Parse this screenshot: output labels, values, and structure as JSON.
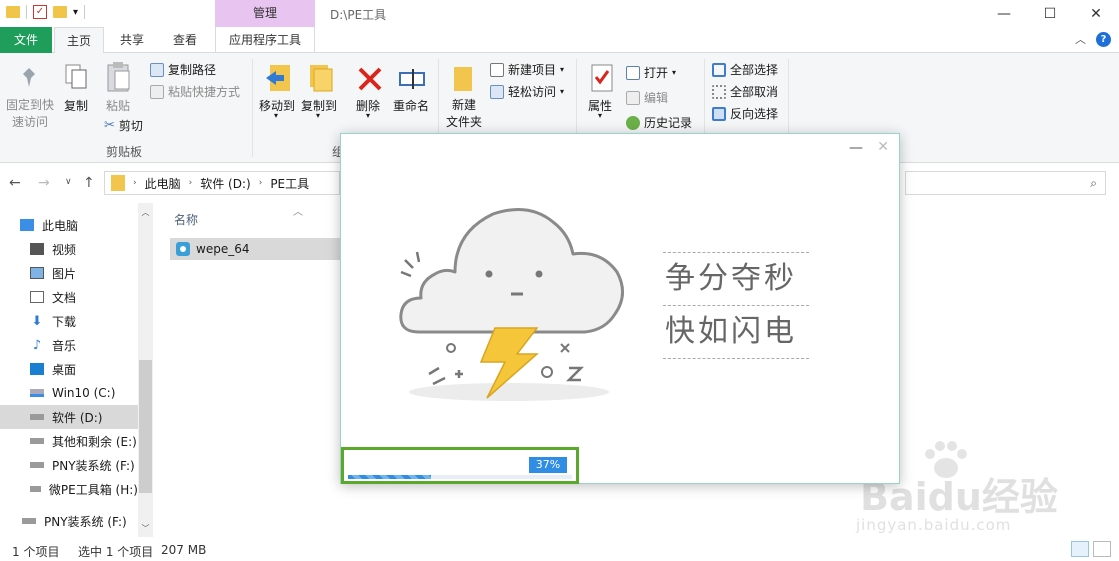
{
  "window": {
    "title": "D:\\PE工具",
    "manage_tab": "管理",
    "minimize": "—",
    "maximize": "☐",
    "close": "✕"
  },
  "tabs": {
    "file": "文件",
    "home": "主页",
    "share": "共享",
    "view": "查看",
    "app_tools": "应用程序工具"
  },
  "ribbon": {
    "pin_quick_access": "固定到快速访问",
    "copy": "复制",
    "paste": "粘贴",
    "copy_path": "复制路径",
    "paste_shortcut": "粘贴快捷方式",
    "cut": "剪切",
    "clipboard_group": "剪贴板",
    "move_to": "移动到",
    "copy_to": "复制到",
    "delete": "删除",
    "rename": "重命名",
    "organize_group_partial": "组",
    "new_folder": "新建\n文件夹",
    "new_item": "新建项目",
    "easy_access": "轻松访问",
    "properties": "属性",
    "open": "打开",
    "edit": "编辑",
    "history": "历史记录",
    "select_all": "全部选择",
    "select_none": "全部取消",
    "invert_selection": "反向选择"
  },
  "address": {
    "breadcrumb": [
      "此电脑",
      "软件 (D:)",
      "PE工具"
    ]
  },
  "sidebar": {
    "items": [
      {
        "label": "此电脑",
        "icon": "computer-icon"
      },
      {
        "label": "视频",
        "icon": "video-icon"
      },
      {
        "label": "图片",
        "icon": "pictures-icon"
      },
      {
        "label": "文档",
        "icon": "documents-icon"
      },
      {
        "label": "下载",
        "icon": "download-icon"
      },
      {
        "label": "音乐",
        "icon": "music-icon"
      },
      {
        "label": "桌面",
        "icon": "desktop-icon"
      },
      {
        "label": "Win10 (C:)",
        "icon": "system-drive-icon"
      },
      {
        "label": "软件 (D:)",
        "icon": "drive-icon"
      },
      {
        "label": "其他和剩余 (E:)",
        "icon": "drive-icon"
      },
      {
        "label": "PNY装系统 (F:)",
        "icon": "drive-icon"
      },
      {
        "label": "微PE工具箱 (H:)",
        "icon": "drive-icon"
      },
      {
        "label": "PNY装系统 (F:)",
        "icon": "drive-icon"
      }
    ]
  },
  "filelist": {
    "column_name": "名称",
    "files": [
      {
        "name": "wepe_64",
        "icon": "disc-app-icon"
      }
    ]
  },
  "status": {
    "item_count": "1 个项目",
    "selected": "选中 1 个项目",
    "size": "207 MB"
  },
  "installer": {
    "slogan_line1": "争分夺秒",
    "slogan_line2": "快如闪电",
    "progress_percent": 37,
    "progress_label": "37%",
    "minimize": "—",
    "close": "✕"
  },
  "watermark": {
    "brand": "Baidu经验",
    "url": "jingyan.baidu.com"
  },
  "colors": {
    "file_tab": "#1e9e5a",
    "manage_tab": "#e8c4f0",
    "progress_fill": "#2f8de4",
    "progress_frame": "#5aa92b",
    "selection": "#d9d9d9"
  }
}
